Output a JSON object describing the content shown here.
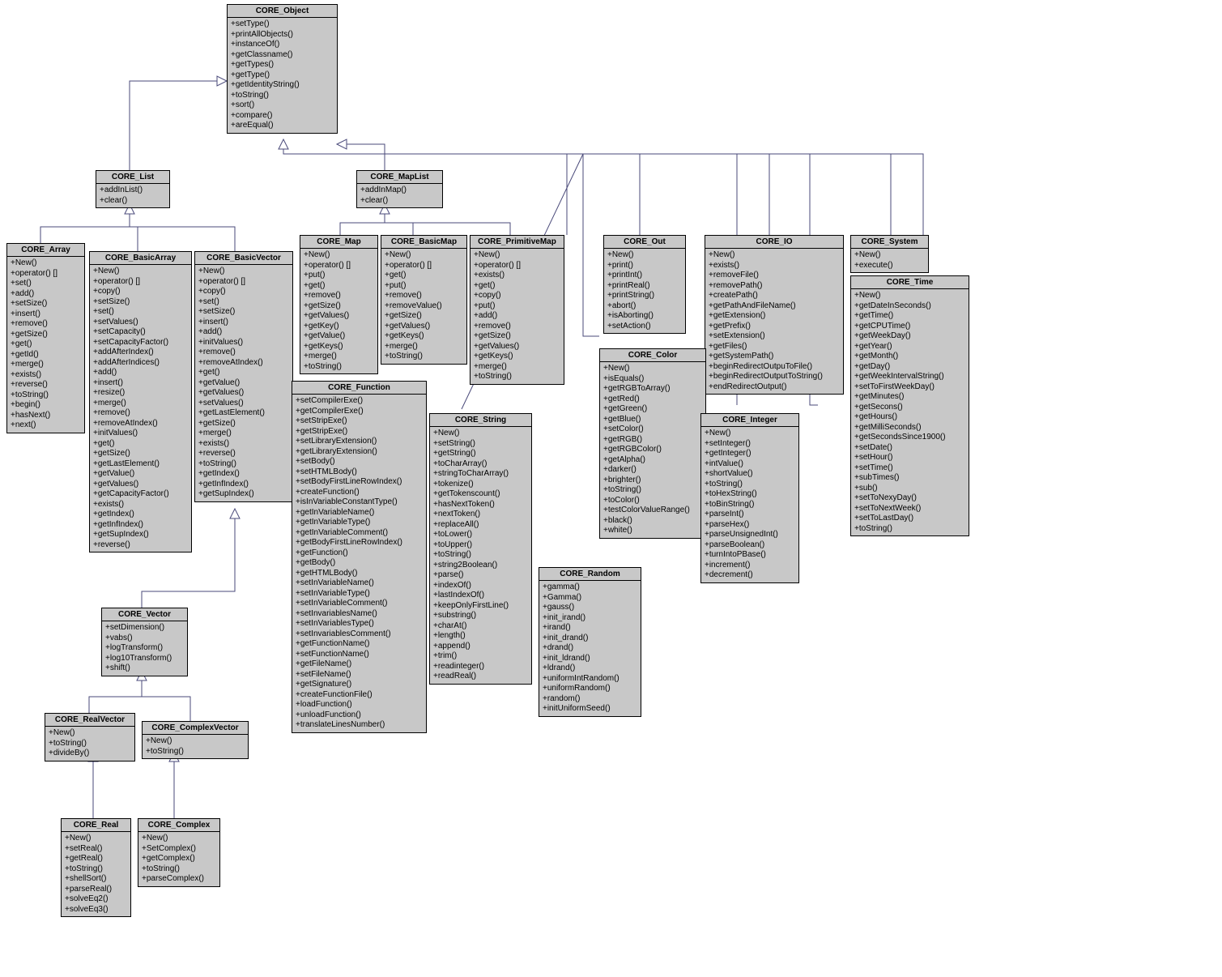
{
  "diagram_type": "uml_class_diagram",
  "classes": {
    "CORE_Object": {
      "title": "CORE_Object",
      "methods": [
        "+setType()",
        "+printAllObjects()",
        "+instanceOf()",
        "+getClassname()",
        "+getTypes()",
        "+getType()",
        "+getIdentityString()",
        "+toString()",
        "+sort()",
        "+compare()",
        "+areEqual()"
      ]
    },
    "CORE_List": {
      "title": "CORE_List",
      "methods": [
        "+addInList()",
        "+clear()"
      ]
    },
    "CORE_MapList": {
      "title": "CORE_MapList",
      "methods": [
        "+addInMap()",
        "+clear()"
      ]
    },
    "CORE_Array": {
      "title": "CORE_Array",
      "methods": [
        "+New()",
        "+operator() []",
        "+set()",
        "+add()",
        "+setSize()",
        "+insert()",
        "+remove()",
        "+getSize()",
        "+get()",
        "+getId()",
        "+merge()",
        "+exists()",
        "+reverse()",
        "+toString()",
        "+begin()",
        "+hasNext()",
        "+next()"
      ]
    },
    "CORE_BasicArray": {
      "title": "CORE_BasicArray",
      "methods": [
        "+New()",
        "+operator() []",
        "+copy()",
        "+setSize()",
        "+set()",
        "+setValues()",
        "+setCapacity()",
        "+setCapacityFactor()",
        "+addAfterIndex()",
        "+addAfterIndices()",
        "+add()",
        "+insert()",
        "+resize()",
        "+merge()",
        "+remove()",
        "+removeAtIndex()",
        "+initValues()",
        "+get()",
        "+getSize()",
        "+getLastElement()",
        "+getValue()",
        "+getValues()",
        "+getCapacityFactor()",
        "+exists()",
        "+getIndex()",
        "+getInfIndex()",
        "+getSupIndex()",
        "+reverse()"
      ]
    },
    "CORE_BasicVector": {
      "title": "CORE_BasicVector",
      "methods": [
        "+New()",
        "+operator() []",
        "+copy()",
        "+set()",
        "+setSize()",
        "+insert()",
        "+add()",
        "+initValues()",
        "+remove()",
        "+removeAtIndex()",
        "+get()",
        "+getValue()",
        "+getValues()",
        "+setValues()",
        "+getLastElement()",
        "+getSize()",
        "+merge()",
        "+exists()",
        "+reverse()",
        "+toString()",
        "+getIndex()",
        "+getInfIndex()",
        "+getSupIndex()"
      ]
    },
    "CORE_Map": {
      "title": "CORE_Map",
      "methods": [
        "+New()",
        "+operator() []",
        "+put()",
        "+get()",
        "+remove()",
        "+getSize()",
        "+getValues()",
        "+getKey()",
        "+getValue()",
        "+getKeys()",
        "+merge()",
        "+toString()"
      ]
    },
    "CORE_BasicMap": {
      "title": "CORE_BasicMap",
      "methods": [
        "+New()",
        "+operator() []",
        "+get()",
        "+put()",
        "+remove()",
        "+removeValue()",
        "+getSize()",
        "+getValues()",
        "+getKeys()",
        "+merge()",
        "+toString()"
      ]
    },
    "CORE_PrimitiveMap": {
      "title": "CORE_PrimitiveMap",
      "methods": [
        "+New()",
        "+operator() []",
        "+exists()",
        "+get()",
        "+copy()",
        "+put()",
        "+add()",
        "+remove()",
        "+getSize()",
        "+getValues()",
        "+getKeys()",
        "+merge()",
        "+toString()"
      ]
    },
    "CORE_Out": {
      "title": "CORE_Out",
      "methods": [
        "+New()",
        "+print()",
        "+printInt()",
        "+printReal()",
        "+printString()",
        "+abort()",
        "+isAborting()",
        "+setAction()"
      ]
    },
    "CORE_IO": {
      "title": "CORE_IO",
      "methods": [
        "+New()",
        "+exists()",
        "+removeFile()",
        "+removePath()",
        "+createPath()",
        "+getPathAndFileName()",
        "+getExtension()",
        "+getPrefix()",
        "+setExtension()",
        "+getFiles()",
        "+getSystemPath()",
        "+beginRedirectOutpuToFile()",
        "+beginRedirectOutputToString()",
        "+endRedirectOutput()"
      ]
    },
    "CORE_System": {
      "title": "CORE_System",
      "methods": [
        "+New()",
        "+execute()"
      ]
    },
    "CORE_Time": {
      "title": "CORE_Time",
      "methods": [
        "+New()",
        "+getDateInSeconds()",
        "+getTime()",
        "+getCPUTime()",
        "+getWeekDay()",
        "+getYear()",
        "+getMonth()",
        "+getDay()",
        "+getWeekIntervalString()",
        "+setToFirstWeekDay()",
        "+getMinutes()",
        "+getSecons()",
        "+getHours()",
        "+getMilliSeconds()",
        "+getSecondsSince1900()",
        "+setDate()",
        "+setHour()",
        "+setTime()",
        "+subTimes()",
        "+sub()",
        "+setToNexyDay()",
        "+setToNextWeek()",
        "+setToLastDay()",
        "+toString()"
      ]
    },
    "CORE_Color": {
      "title": "CORE_Color",
      "methods": [
        "+New()",
        "+isEquals()",
        "+getRGBToArray()",
        "+getRed()",
        "+getGreen()",
        "+getBlue()",
        "+setColor()",
        "+getRGB()",
        "+getRGBColor()",
        "+getAlpha()",
        "+darker()",
        "+brighter()",
        "+toString()",
        "+toColor()",
        "+testColorValueRange()",
        "+black()",
        "+white()"
      ]
    },
    "CORE_Integer": {
      "title": "CORE_Integer",
      "methods": [
        "+New()",
        "+setInteger()",
        "+getInteger()",
        "+intValue()",
        "+shortValue()",
        "+toString()",
        "+toHexString()",
        "+toBinString()",
        "+parseInt()",
        "+parseHex()",
        "+parseUnsignedInt()",
        "+parseBoolean()",
        "+turnIntoPBase()",
        "+increment()",
        "+decrement()"
      ]
    },
    "CORE_Function": {
      "title": "CORE_Function",
      "methods": [
        "+setCompilerExe()",
        "+getCompilerExe()",
        "+setStripExe()",
        "+getStripExe()",
        "+setLibraryExtension()",
        "+getLibraryExtension()",
        "+setBody()",
        "+setHTMLBody()",
        "+setBodyFirstLineRowIndex()",
        "+createFunction()",
        "+isInVariableConstantType()",
        "+getInVariableName()",
        "+getInVariableType()",
        "+getInVariableComment()",
        "+getBodyFirstLineRowIndex()",
        "+getFunction()",
        "+getBody()",
        "+getHTMLBody()",
        "+setInVariableName()",
        "+setInVariableType()",
        "+setInVariableComment()",
        "+setInvariablesName()",
        "+setInVariablesType()",
        "+setInvariablesComment()",
        "+getFunctionName()",
        "+setFunctionName()",
        "+getFileName()",
        "+setFileName()",
        "+getSignature()",
        "+createFunctionFile()",
        "+loadFunction()",
        "+unloadFunction()",
        "+translateLinesNumber()"
      ]
    },
    "CORE_String": {
      "title": "CORE_String",
      "methods": [
        "+New()",
        "+setString()",
        "+getString()",
        "+toCharArray()",
        "+stringToCharArray()",
        "+tokenize()",
        "+getTokenscount()",
        "+hasNextToken()",
        "+nextToken()",
        "+replaceAll()",
        "+toLower()",
        "+toUpper()",
        "+toString()",
        "+string2Boolean()",
        "+parse()",
        "+indexOf()",
        "+lastIndexOf()",
        "+keepOnlyFirstLine()",
        "+substring()",
        "+charAt()",
        "+length()",
        "+append()",
        "+trim()",
        "+readinteger()",
        "+readReal()"
      ]
    },
    "CORE_Random": {
      "title": "CORE_Random",
      "methods": [
        "+gamma()",
        "+Gamma()",
        "+gauss()",
        "+init_irand()",
        "+irand()",
        "+init_drand()",
        "+drand()",
        "+init_ldrand()",
        "+ldrand()",
        "+uniformIntRandom()",
        "+uniformRandom()",
        "+random()",
        "+initUniformSeed()"
      ]
    },
    "CORE_Vector": {
      "title": "CORE_Vector",
      "methods": [
        "+setDimension()",
        "+vabs()",
        "+logTransform()",
        "+log10Transform()",
        "+shift()"
      ]
    },
    "CORE_RealVector": {
      "title": "CORE_RealVector",
      "methods": [
        "+New()",
        "+toString()",
        "+divideBy()"
      ]
    },
    "CORE_ComplexVector": {
      "title": "CORE_ComplexVector",
      "methods": [
        "+New()",
        "+toString()"
      ]
    },
    "CORE_Real": {
      "title": "CORE_Real",
      "methods": [
        "+New()",
        "+setReal()",
        "+getReal()",
        "+toString()",
        "+shellSort()",
        "+parseReal()",
        "+solveEq2()",
        "+solveEq3()"
      ]
    },
    "CORE_Complex": {
      "title": "CORE_Complex",
      "methods": [
        "+New()",
        "+SetComplex()",
        "+getComplex()",
        "+toString()",
        "+parseComplex()"
      ]
    }
  },
  "inheritance_edges": [
    [
      "CORE_List",
      "CORE_Object"
    ],
    [
      "CORE_MapList",
      "CORE_Object"
    ],
    [
      "CORE_Array",
      "CORE_List"
    ],
    [
      "CORE_BasicArray",
      "CORE_List"
    ],
    [
      "CORE_BasicVector",
      "CORE_List"
    ],
    [
      "CORE_Map",
      "CORE_MapList"
    ],
    [
      "CORE_BasicMap",
      "CORE_MapList"
    ],
    [
      "CORE_PrimitiveMap",
      "CORE_MapList"
    ],
    [
      "CORE_Out",
      "CORE_Object"
    ],
    [
      "CORE_IO",
      "CORE_Object"
    ],
    [
      "CORE_System",
      "CORE_Object"
    ],
    [
      "CORE_Time",
      "CORE_Object"
    ],
    [
      "CORE_Color",
      "CORE_Object"
    ],
    [
      "CORE_Integer",
      "CORE_Object"
    ],
    [
      "CORE_Function",
      "CORE_Object"
    ],
    [
      "CORE_String",
      "CORE_Object"
    ],
    [
      "CORE_Random",
      "CORE_Object"
    ],
    [
      "CORE_Vector",
      "CORE_BasicVector"
    ],
    [
      "CORE_RealVector",
      "CORE_Vector"
    ],
    [
      "CORE_ComplexVector",
      "CORE_Vector"
    ],
    [
      "CORE_Real",
      "CORE_RealVector"
    ],
    [
      "CORE_Complex",
      "CORE_ComplexVector"
    ]
  ]
}
